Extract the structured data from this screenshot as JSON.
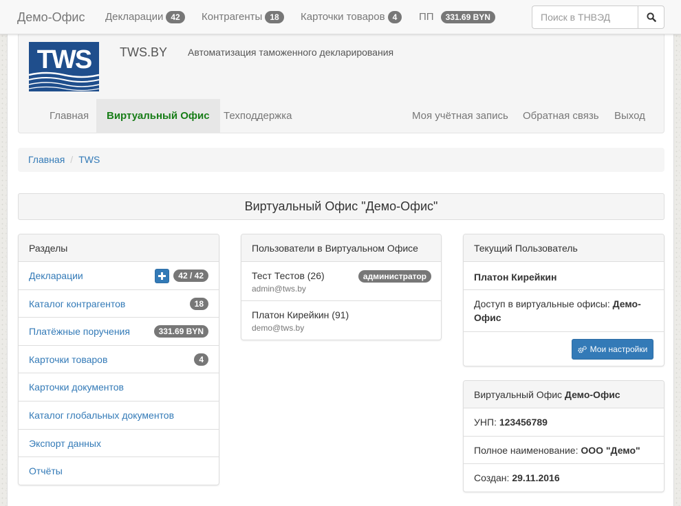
{
  "topnav": {
    "brand": "Демо-Офис",
    "items": [
      {
        "label": "Декларации",
        "badge": "42"
      },
      {
        "label": "Контрагенты",
        "badge": "18"
      },
      {
        "label": "Карточки товаров",
        "badge": "4"
      },
      {
        "label": "ПП",
        "badge": "331.69 BYN"
      }
    ],
    "search_placeholder": "Поиск в ТНВЭД"
  },
  "header": {
    "logo_text": "TWS",
    "title": "TWS.BY",
    "subtitle": "Автоматизация таможенного декларирования",
    "nav_left": [
      "Главная",
      "Виртуальный Офис",
      "Техподдержка"
    ],
    "nav_right": [
      "Моя учётная запись",
      "Обратная связь",
      "Выход"
    ],
    "active_index": 1
  },
  "breadcrumb": [
    "Главная",
    "TWS"
  ],
  "office_title": "Виртуальный Офис \"Демо-Офис\"",
  "sections": {
    "title": "Разделы",
    "items": [
      {
        "label": "Декларации",
        "badge": "42 / 42",
        "has_add": true
      },
      {
        "label": "Каталог контрагентов",
        "badge": "18"
      },
      {
        "label": "Платёжные поручения",
        "badge": "331.69 BYN"
      },
      {
        "label": "Карточки товаров",
        "badge": "4"
      },
      {
        "label": "Карточки документов"
      },
      {
        "label": "Каталог глобальных документов"
      },
      {
        "label": "Экспорт данных"
      },
      {
        "label": "Отчёты"
      }
    ]
  },
  "users": {
    "title": "Пользователи в Виртуальном Офисе",
    "items": [
      {
        "name": "Тест Тестов (26)",
        "email": "admin@tws.by",
        "role": "администратор"
      },
      {
        "name": "Платон Кирейкин (91)",
        "email": "demo@tws.by"
      }
    ]
  },
  "current_user": {
    "title": "Текущий Пользователь",
    "name": "Платон Кирейкин",
    "access_label": "Доступ в виртуальные офисы:",
    "access_value": "Демо-Офис",
    "settings_button": "Мои настройки"
  },
  "office_info": {
    "title_prefix": "Виртуальный Офис",
    "title_name": "Демо-Офис",
    "unp_label": "УНП:",
    "unp_value": "123456789",
    "fullname_label": "Полное наименование:",
    "fullname_value": "ООО \"Демо\"",
    "created_label": "Создан:",
    "created_value": "29.11.2016"
  },
  "colors": {
    "link": "#337ab7",
    "active_nav": "#177d17",
    "badge": "#777777",
    "primary": "#337ab7"
  }
}
